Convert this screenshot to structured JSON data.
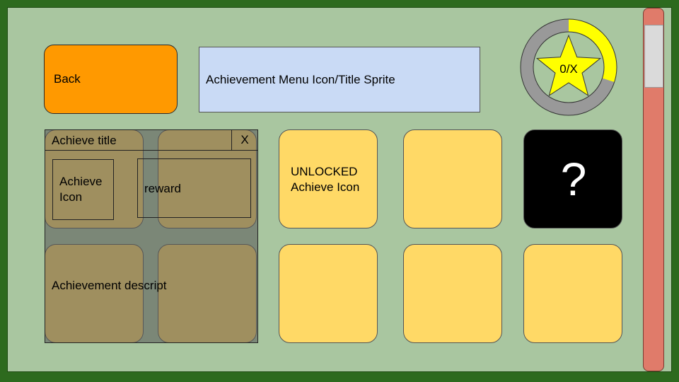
{
  "header": {
    "back_label": "Back",
    "title_sprite": "Achievement Menu Icon/Title Sprite"
  },
  "progress": {
    "label": "0/X",
    "fraction": 0.3,
    "ring_track_color": "#999999",
    "ring_fill_color": "#ffff00",
    "star_color": "#ffff00"
  },
  "grid": {
    "unlocked_label": "UNLOCKED\nAchieve Icon",
    "locked_label": "?",
    "tile_color": "#ffd966",
    "locked_color": "#000000"
  },
  "popup": {
    "title": "Achieve title",
    "close_label": "X",
    "icon_label": "Achieve\nIcon",
    "reward_label": "reward",
    "description": "Achievement descript"
  },
  "scrollbar": {
    "track_color": "#e07b6a",
    "thumb_color": "#dadada"
  }
}
